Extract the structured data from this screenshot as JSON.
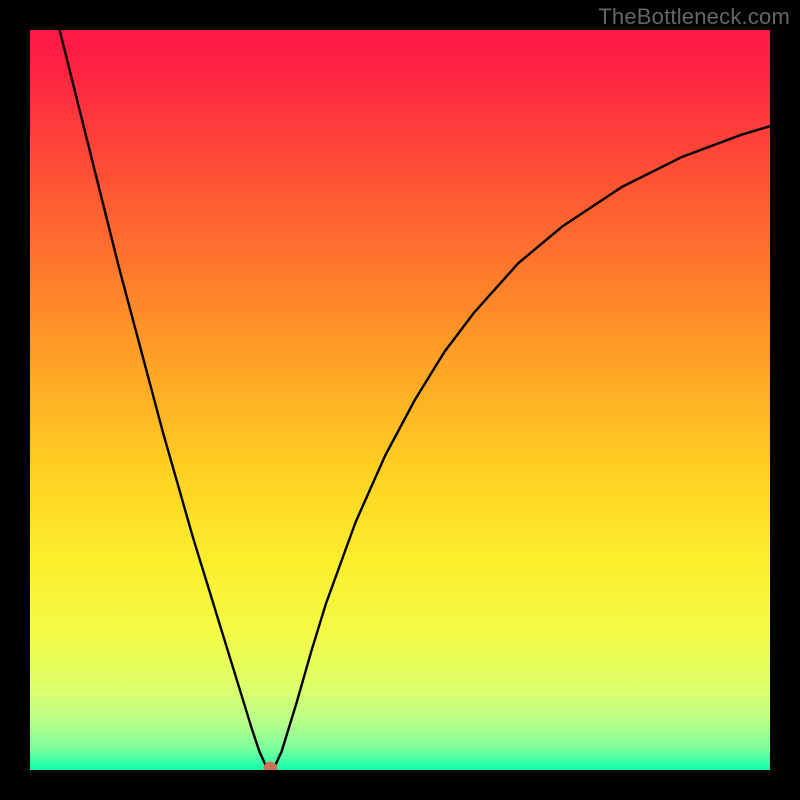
{
  "watermark": "TheBottleneck.com",
  "chart_data": {
    "type": "line",
    "title": "",
    "xlabel": "",
    "ylabel": "",
    "xlim": [
      0,
      100
    ],
    "ylim": [
      0,
      100
    ],
    "series": [
      {
        "name": "curve",
        "x": [
          4,
          6,
          8,
          10,
          12,
          14,
          16,
          18,
          20,
          22,
          24,
          26,
          28,
          30,
          31,
          32,
          33,
          34,
          36,
          38,
          40,
          44,
          48,
          52,
          56,
          60,
          66,
          72,
          80,
          88,
          96,
          100
        ],
        "values": [
          100,
          92,
          84,
          76,
          68,
          60.5,
          53,
          45.5,
          38.5,
          31.5,
          25,
          18.5,
          12,
          5.5,
          2.5,
          0.3,
          0.3,
          2.5,
          9,
          16,
          22.5,
          33.5,
          42.5,
          50,
          56.5,
          61.8,
          68.5,
          73.5,
          78.8,
          82.8,
          85.8,
          87
        ]
      }
    ],
    "marker": {
      "x": 32.5,
      "y": 0.2,
      "color": "#cd6f59"
    },
    "background_gradient": {
      "stops": [
        {
          "offset": 0.0,
          "color": "#ff1846"
        },
        {
          "offset": 0.06,
          "color": "#ff2542"
        },
        {
          "offset": 0.14,
          "color": "#ff3f3a"
        },
        {
          "offset": 0.25,
          "color": "#ff6131"
        },
        {
          "offset": 0.36,
          "color": "#ff852a"
        },
        {
          "offset": 0.48,
          "color": "#ffac24"
        },
        {
          "offset": 0.6,
          "color": "#ffd222"
        },
        {
          "offset": 0.72,
          "color": "#fcef2d"
        },
        {
          "offset": 0.82,
          "color": "#f2fc47"
        },
        {
          "offset": 0.88,
          "color": "#e1ff66"
        },
        {
          "offset": 0.93,
          "color": "#bdff86"
        },
        {
          "offset": 0.97,
          "color": "#80ff9e"
        },
        {
          "offset": 1.0,
          "color": "#11ffab"
        }
      ]
    },
    "curve_color": "#000000",
    "curve_width": 2.4
  }
}
